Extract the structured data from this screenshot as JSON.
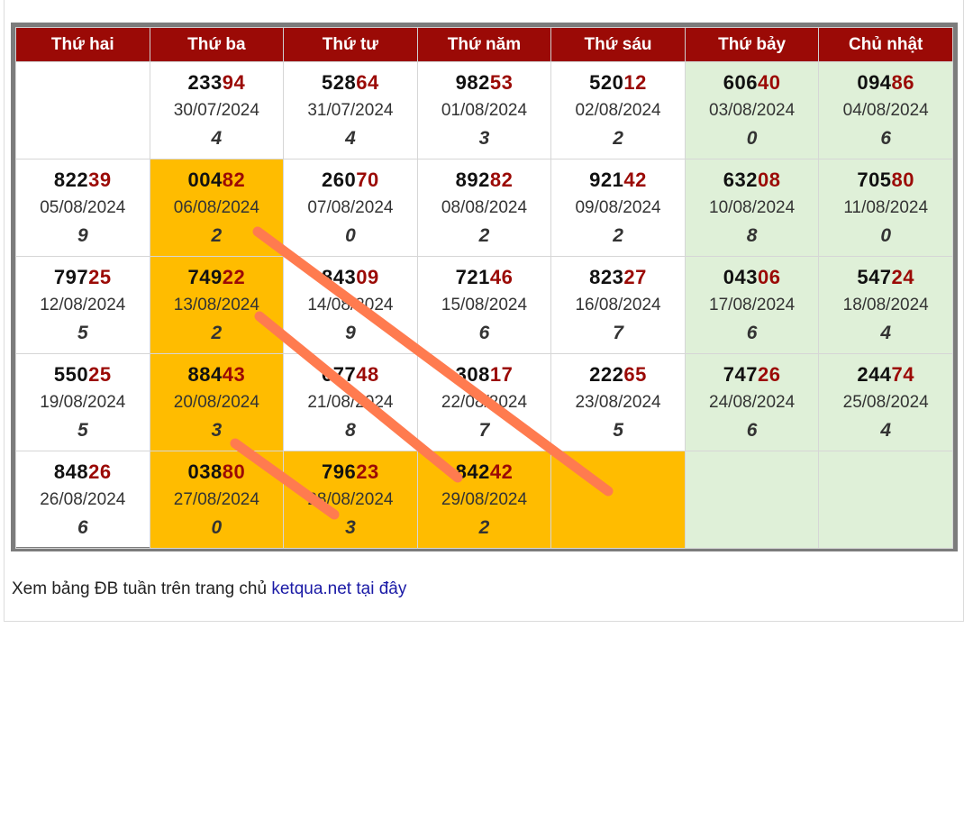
{
  "colors": {
    "header_bg": "#9b0a06",
    "tail_digits": "#9b0a06",
    "highlight": "#ffbc00",
    "weekend": "#dff0d8",
    "stroke": "#ff7b4f",
    "link": "#1a1aa6"
  },
  "table": {
    "headers": [
      "Thứ hai",
      "Thứ ba",
      "Thứ tư",
      "Thứ năm",
      "Thứ sáu",
      "Thứ bảy",
      "Chủ nhật"
    ],
    "rows": [
      [
        {
          "head": "",
          "tail": "",
          "date": "",
          "digit": "",
          "weekend": false,
          "hl": false
        },
        {
          "head": "233",
          "tail": "94",
          "date": "30/07/2024",
          "digit": "4",
          "weekend": false,
          "hl": false
        },
        {
          "head": "528",
          "tail": "64",
          "date": "31/07/2024",
          "digit": "4",
          "weekend": false,
          "hl": false
        },
        {
          "head": "982",
          "tail": "53",
          "date": "01/08/2024",
          "digit": "3",
          "weekend": false,
          "hl": false
        },
        {
          "head": "520",
          "tail": "12",
          "date": "02/08/2024",
          "digit": "2",
          "weekend": false,
          "hl": false
        },
        {
          "head": "606",
          "tail": "40",
          "date": "03/08/2024",
          "digit": "0",
          "weekend": true,
          "hl": false
        },
        {
          "head": "094",
          "tail": "86",
          "date": "04/08/2024",
          "digit": "6",
          "weekend": true,
          "hl": false
        }
      ],
      [
        {
          "head": "822",
          "tail": "39",
          "date": "05/08/2024",
          "digit": "9",
          "weekend": false,
          "hl": false
        },
        {
          "head": "004",
          "tail": "82",
          "date": "06/08/2024",
          "digit": "2",
          "weekend": false,
          "hl": true
        },
        {
          "head": "260",
          "tail": "70",
          "date": "07/08/2024",
          "digit": "0",
          "weekend": false,
          "hl": false
        },
        {
          "head": "892",
          "tail": "82",
          "date": "08/08/2024",
          "digit": "2",
          "weekend": false,
          "hl": false
        },
        {
          "head": "921",
          "tail": "42",
          "date": "09/08/2024",
          "digit": "2",
          "weekend": false,
          "hl": false
        },
        {
          "head": "632",
          "tail": "08",
          "date": "10/08/2024",
          "digit": "8",
          "weekend": true,
          "hl": false
        },
        {
          "head": "705",
          "tail": "80",
          "date": "11/08/2024",
          "digit": "0",
          "weekend": true,
          "hl": false
        }
      ],
      [
        {
          "head": "797",
          "tail": "25",
          "date": "12/08/2024",
          "digit": "5",
          "weekend": false,
          "hl": false
        },
        {
          "head": "749",
          "tail": "22",
          "date": "13/08/2024",
          "digit": "2",
          "weekend": false,
          "hl": true
        },
        {
          "head": "843",
          "tail": "09",
          "date": "14/08/2024",
          "digit": "9",
          "weekend": false,
          "hl": false
        },
        {
          "head": "721",
          "tail": "46",
          "date": "15/08/2024",
          "digit": "6",
          "weekend": false,
          "hl": false
        },
        {
          "head": "823",
          "tail": "27",
          "date": "16/08/2024",
          "digit": "7",
          "weekend": false,
          "hl": false
        },
        {
          "head": "043",
          "tail": "06",
          "date": "17/08/2024",
          "digit": "6",
          "weekend": true,
          "hl": false
        },
        {
          "head": "547",
          "tail": "24",
          "date": "18/08/2024",
          "digit": "4",
          "weekend": true,
          "hl": false
        }
      ],
      [
        {
          "head": "550",
          "tail": "25",
          "date": "19/08/2024",
          "digit": "5",
          "weekend": false,
          "hl": false
        },
        {
          "head": "884",
          "tail": "43",
          "date": "20/08/2024",
          "digit": "3",
          "weekend": false,
          "hl": true
        },
        {
          "head": "677",
          "tail": "48",
          "date": "21/08/2024",
          "digit": "8",
          "weekend": false,
          "hl": false
        },
        {
          "head": "308",
          "tail": "17",
          "date": "22/08/2024",
          "digit": "7",
          "weekend": false,
          "hl": false
        },
        {
          "head": "222",
          "tail": "65",
          "date": "23/08/2024",
          "digit": "5",
          "weekend": false,
          "hl": false
        },
        {
          "head": "747",
          "tail": "26",
          "date": "24/08/2024",
          "digit": "6",
          "weekend": true,
          "hl": false
        },
        {
          "head": "244",
          "tail": "74",
          "date": "25/08/2024",
          "digit": "4",
          "weekend": true,
          "hl": false
        }
      ],
      [
        {
          "head": "848",
          "tail": "26",
          "date": "26/08/2024",
          "digit": "6",
          "weekend": false,
          "hl": false
        },
        {
          "head": "038",
          "tail": "80",
          "date": "27/08/2024",
          "digit": "0",
          "weekend": false,
          "hl": true
        },
        {
          "head": "796",
          "tail": "23",
          "date": "28/08/2024",
          "digit": "3",
          "weekend": false,
          "hl": true
        },
        {
          "head": "842",
          "tail": "42",
          "date": "29/08/2024",
          "digit": "2",
          "weekend": false,
          "hl": true
        },
        {
          "head": "",
          "tail": "",
          "date": "",
          "digit": "",
          "weekend": false,
          "hl": true
        },
        {
          "head": "",
          "tail": "",
          "date": "",
          "digit": "",
          "weekend": true,
          "hl": false
        },
        {
          "head": "",
          "tail": "",
          "date": "",
          "digit": "",
          "weekend": true,
          "hl": false
        }
      ]
    ]
  },
  "footer": {
    "text": "Xem bảng ĐB tuần trên trang chủ ",
    "link_text": "ketqua.net tại đây"
  }
}
